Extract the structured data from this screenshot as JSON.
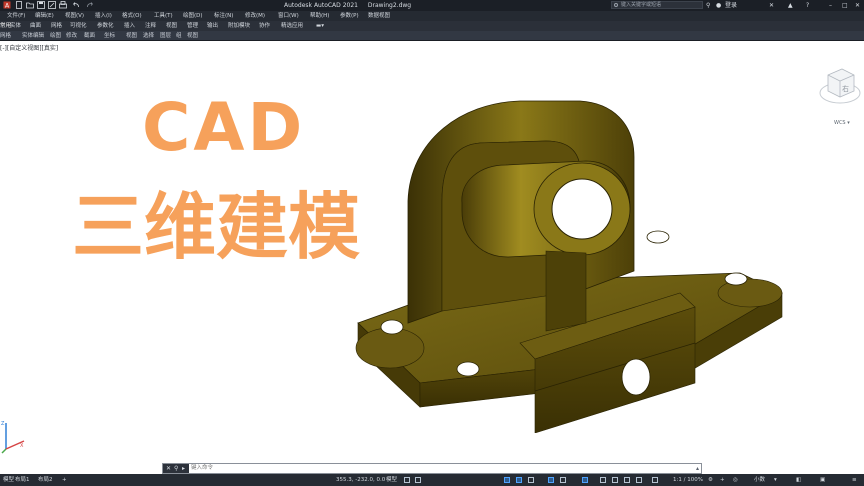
{
  "titlebar": {
    "app": "Autodesk AutoCAD 2021",
    "document": "Drawing2.dwg",
    "search_placeholder": "键入关键字或短语",
    "login_label": "登录"
  },
  "menu": [
    "文件(F)",
    "编辑(E)",
    "视图(V)",
    "插入(I)",
    "格式(O)",
    "工具(T)",
    "绘图(D)",
    "标注(N)",
    "修改(M)",
    "窗口(W)",
    "帮助(H)",
    "参数(P)",
    "数据视图"
  ],
  "ribbon_tabs": [
    "常用",
    "实体",
    "曲面",
    "网格",
    "可视化",
    "参数化",
    "插入",
    "注释",
    "视图",
    "管理",
    "输出",
    "附加模块",
    "协作",
    "精选应用"
  ],
  "panels": [
    "网格",
    "实体编辑",
    "绘图",
    "修改",
    "截面",
    "坐标",
    "视图",
    "选择",
    "图层",
    "组",
    "视图"
  ],
  "viewport": {
    "label": "[-][自定义视图][真实]",
    "overlay_title": "CAD",
    "overlay_subtitle": "三维建模",
    "viewcube_face": "右",
    "wcs_label": "WCS"
  },
  "command": {
    "placeholder": "键入命令"
  },
  "layout_tabs": [
    "模型",
    "布局1",
    "布局2"
  ],
  "status": {
    "coordinates": "355.3, -232.0, 0.0",
    "model_label": "模型",
    "scale": "1:1 / 100%",
    "units": "小数"
  },
  "colors": {
    "model": "#6b5a10",
    "overlay_text": "#f6a15b",
    "titlebar": "#1b1f26"
  }
}
